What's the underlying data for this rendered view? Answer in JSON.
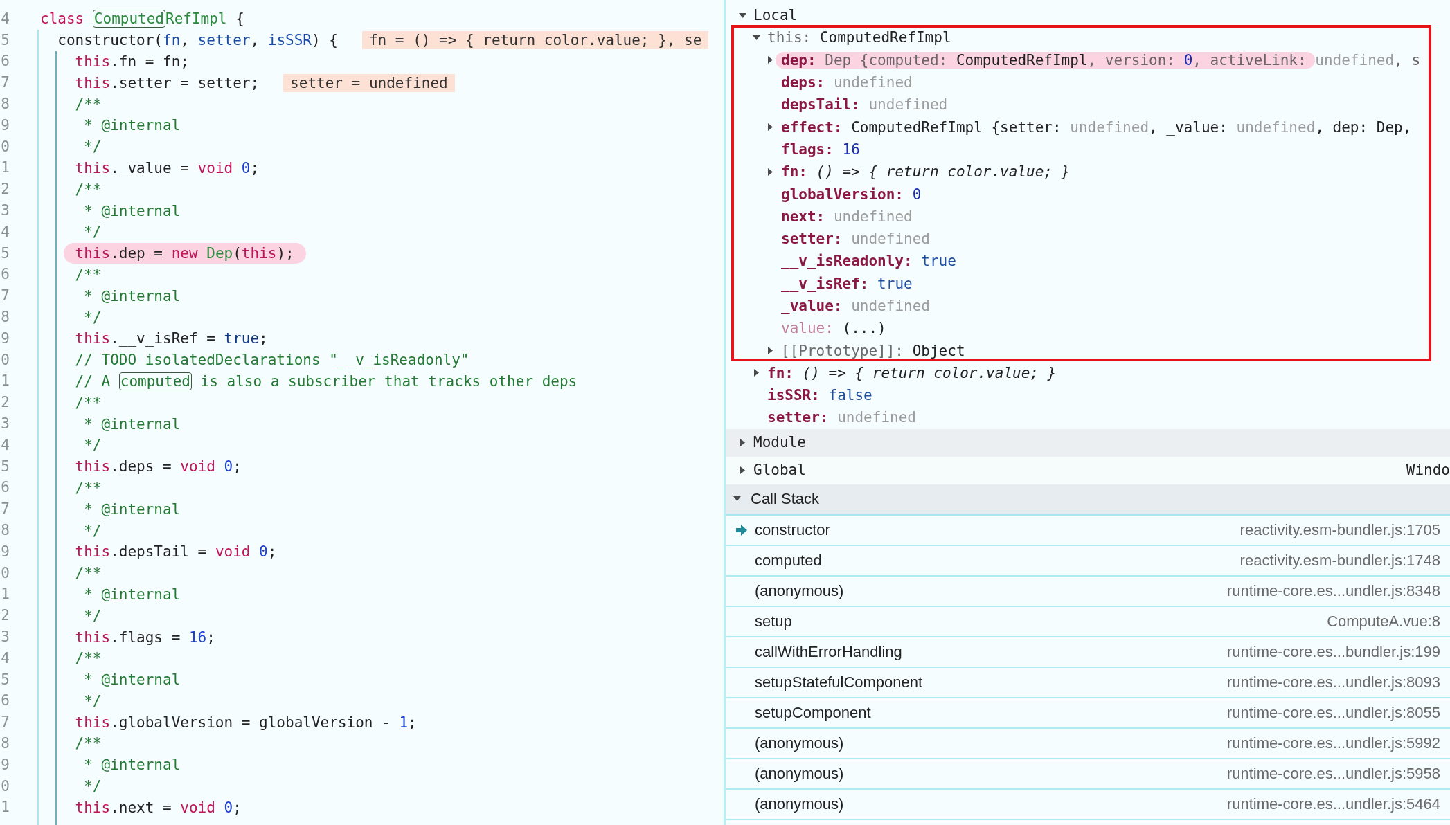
{
  "code": {
    "lines": [
      {
        "number": "4",
        "highlighted": false,
        "tokens": [
          {
            "kind": "keyword",
            "text": "class "
          },
          {
            "kind": "boxed-type",
            "text": "Computed"
          },
          {
            "kind": "type",
            "text": "RefImpl"
          },
          {
            "kind": "plain",
            "text": " {"
          }
        ]
      },
      {
        "number": "5",
        "highlighted": false,
        "tokens": [
          {
            "kind": "plain",
            "text": "  constructor("
          },
          {
            "kind": "param",
            "text": "fn"
          },
          {
            "kind": "plain",
            "text": ", "
          },
          {
            "kind": "param",
            "text": "setter"
          },
          {
            "kind": "plain",
            "text": ", "
          },
          {
            "kind": "param",
            "text": "isSSR"
          },
          {
            "kind": "plain",
            "text": ") {"
          }
        ],
        "inline_value": "fn = () => { return color.value; }, se"
      },
      {
        "number": "6",
        "highlighted": false,
        "tokens": [
          {
            "kind": "keyword",
            "text": "    this"
          },
          {
            "kind": "plain",
            "text": ".fn = fn;"
          }
        ]
      },
      {
        "number": "7",
        "highlighted": false,
        "tokens": [
          {
            "kind": "keyword",
            "text": "    this"
          },
          {
            "kind": "plain",
            "text": ".setter = setter;"
          }
        ],
        "inline_value": "setter = undefined"
      },
      {
        "number": "8",
        "highlighted": false,
        "tokens": [
          {
            "kind": "comment",
            "text": "    /**"
          }
        ]
      },
      {
        "number": "9",
        "highlighted": false,
        "tokens": [
          {
            "kind": "comment",
            "text": "     * @internal"
          }
        ]
      },
      {
        "number": "0",
        "highlighted": false,
        "tokens": [
          {
            "kind": "comment",
            "text": "     */"
          }
        ]
      },
      {
        "number": "1",
        "highlighted": false,
        "tokens": [
          {
            "kind": "keyword",
            "text": "    this"
          },
          {
            "kind": "plain",
            "text": "._value = "
          },
          {
            "kind": "keyword",
            "text": "void "
          },
          {
            "kind": "number",
            "text": "0"
          },
          {
            "kind": "plain",
            "text": ";"
          }
        ]
      },
      {
        "number": "2",
        "highlighted": false,
        "tokens": [
          {
            "kind": "comment",
            "text": "    /**"
          }
        ]
      },
      {
        "number": "3",
        "highlighted": false,
        "tokens": [
          {
            "kind": "comment",
            "text": "     * @internal"
          }
        ]
      },
      {
        "number": "4",
        "highlighted": false,
        "tokens": [
          {
            "kind": "comment",
            "text": "     */"
          }
        ]
      },
      {
        "number": "5",
        "highlighted": true,
        "tokens": [
          {
            "kind": "keyword",
            "text": "    this"
          },
          {
            "kind": "plain",
            "text": ".dep = "
          },
          {
            "kind": "keyword",
            "text": "new "
          },
          {
            "kind": "type",
            "text": "Dep"
          },
          {
            "kind": "plain",
            "text": "("
          },
          {
            "kind": "keyword",
            "text": "this"
          },
          {
            "kind": "plain",
            "text": ");"
          }
        ]
      },
      {
        "number": "6",
        "highlighted": false,
        "tokens": [
          {
            "kind": "comment",
            "text": "    /**"
          }
        ]
      },
      {
        "number": "7",
        "highlighted": false,
        "tokens": [
          {
            "kind": "comment",
            "text": "     * @internal"
          }
        ]
      },
      {
        "number": "8",
        "highlighted": false,
        "tokens": [
          {
            "kind": "comment",
            "text": "     */"
          }
        ]
      },
      {
        "number": "9",
        "highlighted": false,
        "tokens": [
          {
            "kind": "keyword",
            "text": "    this"
          },
          {
            "kind": "plain",
            "text": ".__v_isRef = "
          },
          {
            "kind": "bool",
            "text": "true"
          },
          {
            "kind": "plain",
            "text": ";"
          }
        ]
      },
      {
        "number": "0",
        "highlighted": false,
        "tokens": [
          {
            "kind": "comment",
            "text": "    // TODO isolatedDeclarations \"__v_isReadonly\""
          }
        ]
      },
      {
        "number": "1",
        "highlighted": false,
        "tokens": [
          {
            "kind": "comment",
            "text": "    // A "
          },
          {
            "kind": "boxed-comment",
            "text": "computed"
          },
          {
            "kind": "comment",
            "text": " is also a subscriber that tracks other deps"
          }
        ]
      },
      {
        "number": "2",
        "highlighted": false,
        "tokens": [
          {
            "kind": "comment",
            "text": "    /**"
          }
        ]
      },
      {
        "number": "3",
        "highlighted": false,
        "tokens": [
          {
            "kind": "comment",
            "text": "     * @internal"
          }
        ]
      },
      {
        "number": "4",
        "highlighted": false,
        "tokens": [
          {
            "kind": "comment",
            "text": "     */"
          }
        ]
      },
      {
        "number": "5",
        "highlighted": false,
        "tokens": [
          {
            "kind": "keyword",
            "text": "    this"
          },
          {
            "kind": "plain",
            "text": ".deps = "
          },
          {
            "kind": "keyword",
            "text": "void "
          },
          {
            "kind": "number",
            "text": "0"
          },
          {
            "kind": "plain",
            "text": ";"
          }
        ]
      },
      {
        "number": "6",
        "highlighted": false,
        "tokens": [
          {
            "kind": "comment",
            "text": "    /**"
          }
        ]
      },
      {
        "number": "7",
        "highlighted": false,
        "tokens": [
          {
            "kind": "comment",
            "text": "     * @internal"
          }
        ]
      },
      {
        "number": "8",
        "highlighted": false,
        "tokens": [
          {
            "kind": "comment",
            "text": "     */"
          }
        ]
      },
      {
        "number": "9",
        "highlighted": false,
        "tokens": [
          {
            "kind": "keyword",
            "text": "    this"
          },
          {
            "kind": "plain",
            "text": ".depsTail = "
          },
          {
            "kind": "keyword",
            "text": "void "
          },
          {
            "kind": "number",
            "text": "0"
          },
          {
            "kind": "plain",
            "text": ";"
          }
        ]
      },
      {
        "number": "0",
        "highlighted": false,
        "tokens": [
          {
            "kind": "comment",
            "text": "    /**"
          }
        ]
      },
      {
        "number": "1",
        "highlighted": false,
        "tokens": [
          {
            "kind": "comment",
            "text": "     * @internal"
          }
        ]
      },
      {
        "number": "2",
        "highlighted": false,
        "tokens": [
          {
            "kind": "comment",
            "text": "     */"
          }
        ]
      },
      {
        "number": "3",
        "highlighted": false,
        "tokens": [
          {
            "kind": "keyword",
            "text": "    this"
          },
          {
            "kind": "plain",
            "text": ".flags = "
          },
          {
            "kind": "number",
            "text": "16"
          },
          {
            "kind": "plain",
            "text": ";"
          }
        ]
      },
      {
        "number": "4",
        "highlighted": false,
        "tokens": [
          {
            "kind": "comment",
            "text": "    /**"
          }
        ]
      },
      {
        "number": "5",
        "highlighted": false,
        "tokens": [
          {
            "kind": "comment",
            "text": "     * @internal"
          }
        ]
      },
      {
        "number": "6",
        "highlighted": false,
        "tokens": [
          {
            "kind": "comment",
            "text": "     */"
          }
        ]
      },
      {
        "number": "7",
        "highlighted": false,
        "tokens": [
          {
            "kind": "keyword",
            "text": "    this"
          },
          {
            "kind": "plain",
            "text": ".globalVersion = globalVersion - "
          },
          {
            "kind": "number",
            "text": "1"
          },
          {
            "kind": "plain",
            "text": ";"
          }
        ]
      },
      {
        "number": "8",
        "highlighted": false,
        "tokens": [
          {
            "kind": "comment",
            "text": "    /**"
          }
        ]
      },
      {
        "number": "9",
        "highlighted": false,
        "tokens": [
          {
            "kind": "comment",
            "text": "     * @internal"
          }
        ]
      },
      {
        "number": "0",
        "highlighted": false,
        "tokens": [
          {
            "kind": "comment",
            "text": "     */"
          }
        ]
      },
      {
        "number": "1",
        "highlighted": false,
        "tokens": [
          {
            "kind": "keyword",
            "text": "    this"
          },
          {
            "kind": "plain",
            "text": ".next = "
          },
          {
            "kind": "keyword",
            "text": "void "
          },
          {
            "kind": "number",
            "text": "0"
          },
          {
            "kind": "plain",
            "text": ";"
          }
        ]
      }
    ]
  },
  "scope": {
    "sections": [
      {
        "title": "Local",
        "expanded": true,
        "items": [
          {
            "key": "this:",
            "kind": "internal",
            "expanded": true,
            "highlighted": false,
            "value": [
              {
                "kind": "plain",
                "text": "ComputedRefImpl"
              }
            ],
            "children": [
              {
                "key": "dep:",
                "kind": "own",
                "expanded": false,
                "highlighted": true,
                "value": [
                  {
                    "kind": "preview",
                    "text": "Dep {computed: ",
                    "highlighted": true
                  },
                  {
                    "kind": "plain",
                    "text": "ComputedRefImpl",
                    "highlighted": true
                  },
                  {
                    "kind": "preview",
                    "text": ", version: ",
                    "highlighted": true
                  },
                  {
                    "kind": "number",
                    "text": "0",
                    "highlighted": true
                  },
                  {
                    "kind": "preview",
                    "text": ", activeLink: ",
                    "highlighted": true
                  },
                  {
                    "kind": "dim",
                    "text": "undefined",
                    "highlighted": false
                  },
                  {
                    "kind": "preview",
                    "text": ", s",
                    "highlighted": false
                  }
                ]
              },
              {
                "key": "deps:",
                "kind": "own",
                "highlighted": false,
                "value": [
                  {
                    "kind": "dim",
                    "text": "undefined"
                  }
                ]
              },
              {
                "key": "depsTail:",
                "kind": "own",
                "highlighted": false,
                "value": [
                  {
                    "kind": "dim",
                    "text": "undefined"
                  }
                ]
              },
              {
                "key": "effect:",
                "kind": "own",
                "expanded": false,
                "highlighted": false,
                "value": [
                  {
                    "kind": "plain",
                    "text": "ComputedRefImpl {setter: "
                  },
                  {
                    "kind": "dim",
                    "text": "undefined"
                  },
                  {
                    "kind": "plain",
                    "text": ", _value: "
                  },
                  {
                    "kind": "dim",
                    "text": "undefined"
                  },
                  {
                    "kind": "plain",
                    "text": ", dep: Dep,"
                  }
                ]
              },
              {
                "key": "flags:",
                "kind": "own",
                "highlighted": false,
                "value": [
                  {
                    "kind": "number",
                    "text": "16"
                  }
                ]
              },
              {
                "key": "fn:",
                "kind": "own",
                "expanded": false,
                "highlighted": false,
                "value": [
                  {
                    "kind": "italic",
                    "text": "() => { return color.value; }"
                  }
                ]
              },
              {
                "key": "globalVersion:",
                "kind": "own",
                "highlighted": false,
                "value": [
                  {
                    "kind": "number",
                    "text": "0"
                  }
                ]
              },
              {
                "key": "next:",
                "kind": "own",
                "highlighted": false,
                "value": [
                  {
                    "kind": "dim",
                    "text": "undefined"
                  }
                ]
              },
              {
                "key": "setter:",
                "kind": "own",
                "highlighted": false,
                "value": [
                  {
                    "kind": "dim",
                    "text": "undefined"
                  }
                ]
              },
              {
                "key": "__v_isReadonly:",
                "kind": "own",
                "highlighted": false,
                "value": [
                  {
                    "kind": "bool",
                    "text": "true"
                  }
                ]
              },
              {
                "key": "__v_isRef:",
                "kind": "own",
                "highlighted": false,
                "value": [
                  {
                    "kind": "bool",
                    "text": "true"
                  }
                ]
              },
              {
                "key": "_value:",
                "kind": "own",
                "highlighted": false,
                "value": [
                  {
                    "kind": "dim",
                    "text": "undefined"
                  }
                ]
              },
              {
                "key": "value:",
                "kind": "getter",
                "highlighted": false,
                "value": [
                  {
                    "kind": "plain",
                    "text": "(...)"
                  }
                ]
              },
              {
                "key": "[[Prototype]]:",
                "kind": "internal",
                "expanded": false,
                "highlighted": false,
                "value": [
                  {
                    "kind": "plain",
                    "text": "Object"
                  }
                ]
              }
            ]
          },
          {
            "key": "fn:",
            "kind": "own",
            "expanded": false,
            "highlighted": false,
            "value": [
              {
                "kind": "italic",
                "text": "() => { return color.value; }"
              }
            ]
          },
          {
            "key": "isSSR:",
            "kind": "own",
            "highlighted": false,
            "value": [
              {
                "kind": "bool",
                "text": "false"
              }
            ]
          },
          {
            "key": "setter:",
            "kind": "own",
            "highlighted": false,
            "value": [
              {
                "kind": "dim",
                "text": "undefined"
              }
            ]
          }
        ]
      },
      {
        "title": "Module",
        "expanded": false
      },
      {
        "title": "Global",
        "expanded": false,
        "value": "Windo"
      }
    ]
  },
  "call_stack": {
    "title": "Call Stack",
    "expanded": true,
    "frames": [
      {
        "name": "constructor",
        "location": "reactivity.esm-bundler.js:1705",
        "selected": true
      },
      {
        "name": "computed",
        "location": "reactivity.esm-bundler.js:1748",
        "selected": false
      },
      {
        "name": "(anonymous)",
        "location": "runtime-core.es...undler.js:8348",
        "selected": false
      },
      {
        "name": "setup",
        "location": "ComputeA.vue:8",
        "selected": false
      },
      {
        "name": "callWithErrorHandling",
        "location": "runtime-core.es...bundler.js:199",
        "selected": false
      },
      {
        "name": "setupStatefulComponent",
        "location": "runtime-core.es...undler.js:8093",
        "selected": false
      },
      {
        "name": "setupComponent",
        "location": "runtime-core.es...undler.js:8055",
        "selected": false
      },
      {
        "name": "(anonymous)",
        "location": "runtime-core.es...undler.js:5992",
        "selected": false
      },
      {
        "name": "(anonymous)",
        "location": "runtime-core.es...undler.js:5958",
        "selected": false
      },
      {
        "name": "(anonymous)",
        "location": "runtime-core.es...undler.js:5464",
        "selected": false
      }
    ]
  }
}
